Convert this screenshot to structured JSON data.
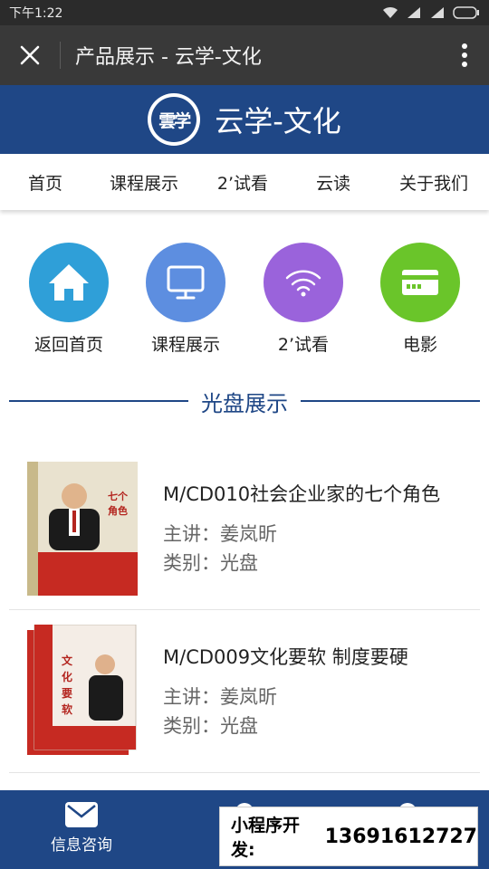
{
  "status_bar": {
    "time": "下午1:22"
  },
  "title_bar": {
    "title": "产品展示 - 云学-文化"
  },
  "brand": {
    "logo_text": "雲学",
    "name": "云学-文化",
    "color": "#1f4786"
  },
  "nav": {
    "items": [
      "首页",
      "课程展示",
      "2’试看",
      "云读",
      "关于我们"
    ]
  },
  "quick_links": [
    {
      "label": "返回首页",
      "icon": "home-icon",
      "color": "#2f9fd8"
    },
    {
      "label": "课程展示",
      "icon": "monitor-icon",
      "color": "#5d8ee0"
    },
    {
      "label": "2’试看",
      "icon": "wifi-icon",
      "color": "#9a63db"
    },
    {
      "label": "电影",
      "icon": "card-icon",
      "color": "#6ac52a"
    }
  ],
  "section": {
    "title": "光盘展示"
  },
  "products": [
    {
      "name": "M/CD010社会企业家的七个角色",
      "lecturer": "主讲：姜岚昕",
      "category": "类别：光盘",
      "cover_text": "七个角色"
    },
    {
      "name": "M/CD009文化要软 制度要硬",
      "lecturer": "主讲：姜岚昕",
      "category": "类别：光盘",
      "cover_text": "文化要软"
    }
  ],
  "bottom_tabs": [
    {
      "label": "信息咨询",
      "icon": "mail-icon"
    }
  ],
  "ad": {
    "label": "小程序开发:",
    "phone": "13691612727"
  }
}
